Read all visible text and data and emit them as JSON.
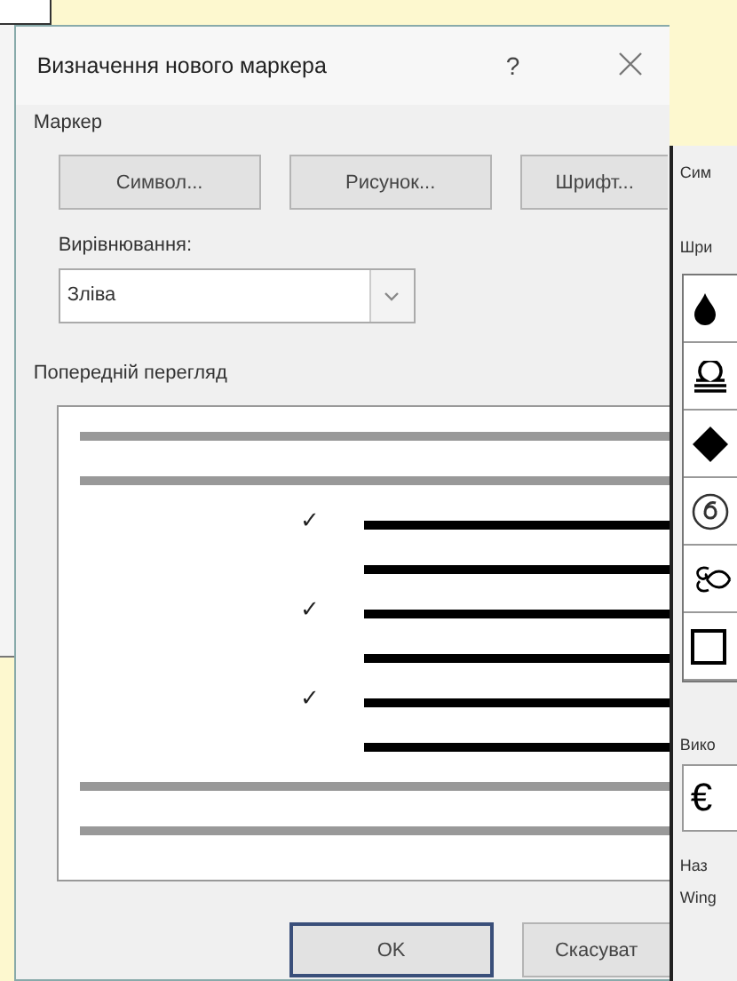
{
  "dialog": {
    "title": "Визначення нового маркера",
    "help": "?",
    "section": "Маркер",
    "buttons": [
      "Символ...",
      "Рисунок...",
      "Шрифт..."
    ],
    "alignment_label": "Вирівнювання:",
    "alignment_value": "Зліва",
    "preview_label": "Попередній перегляд",
    "preview_bullets": [
      "✓",
      "✓",
      "✓"
    ],
    "footer_buttons": [
      {
        "label": "OK",
        "default": true
      },
      {
        "label": "Скасуват",
        "default": false
      }
    ]
  },
  "symbol_dialog": {
    "title": "Сим",
    "font_label": "Шри",
    "symbols": [
      {
        "kind": "drop"
      },
      {
        "kind": "scales"
      },
      {
        "kind": "diamond"
      },
      {
        "kind": "circled-six"
      },
      {
        "kind": "ornament"
      },
      {
        "kind": "square"
      }
    ],
    "recent_label": "Вико",
    "recent": [
      "€"
    ],
    "name_label": "Наз",
    "font_name": "Wing"
  }
}
